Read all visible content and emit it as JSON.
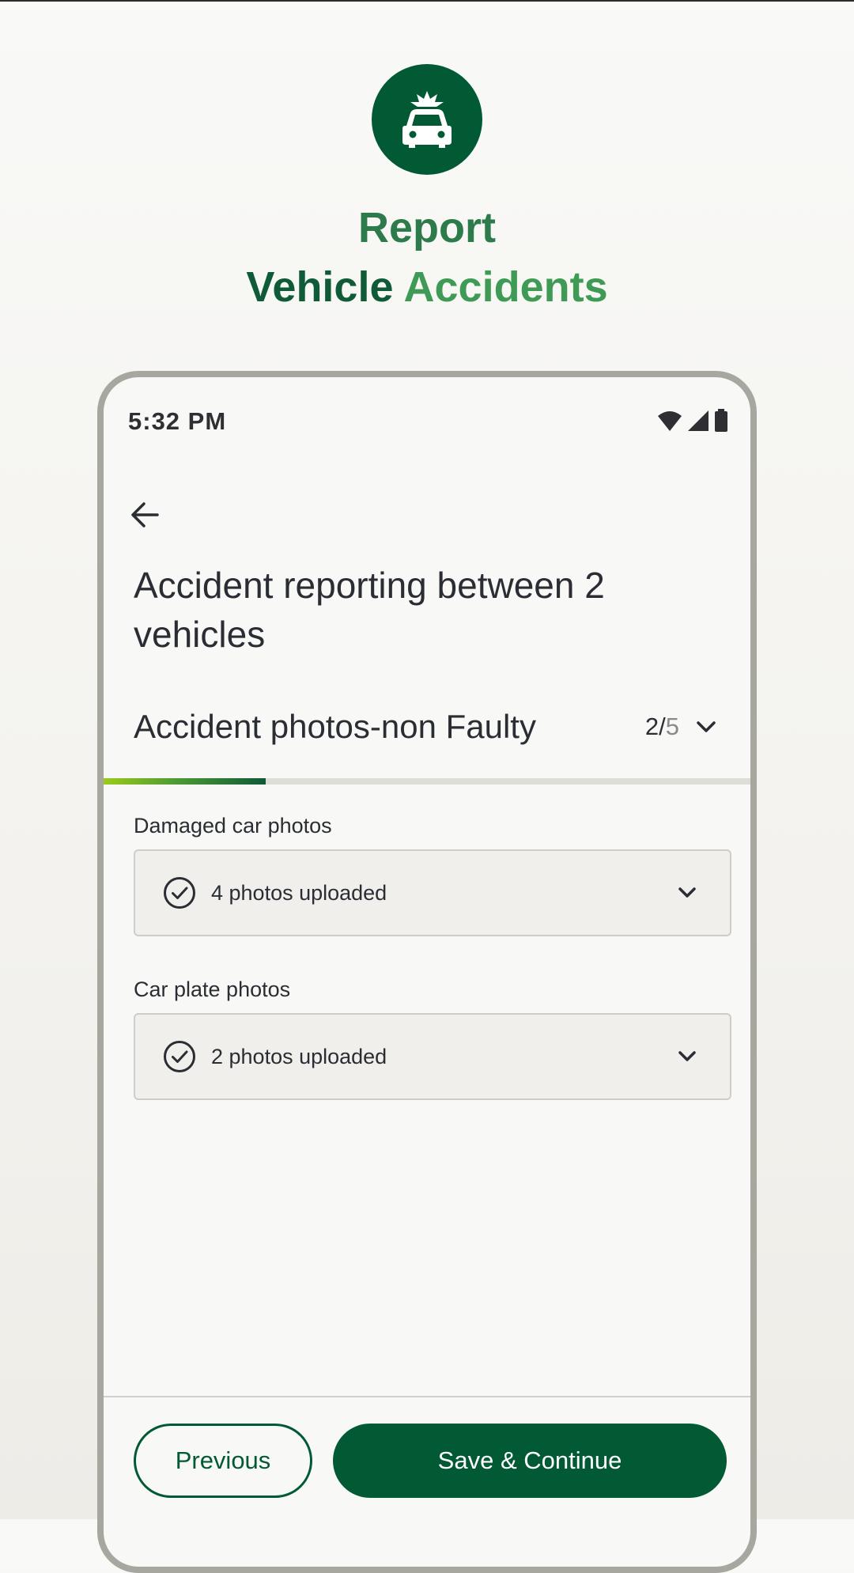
{
  "hero": {
    "title_line1": "Report",
    "title_word_a": "Vehicle",
    "title_word_b": "Accidents",
    "icon": "car-accident-icon"
  },
  "status_bar": {
    "time": "5:32 PM",
    "icons": [
      "wifi-icon",
      "cell-signal-icon",
      "battery-icon"
    ]
  },
  "header": {
    "back_icon": "arrow-left-icon",
    "title": "Accident reporting between 2 vehicles"
  },
  "section": {
    "title": "Accident photos-non Faulty",
    "step_current": "2",
    "step_total": "5",
    "progress": 0.25
  },
  "fields": [
    {
      "label": "Damaged car photos",
      "status": "4 photos uploaded"
    },
    {
      "label": "Car plate photos",
      "status": "2 photos uploaded"
    }
  ],
  "footer": {
    "previous_label": "Previous",
    "save_label": "Save & Continue"
  },
  "colors": {
    "brand_green": "#025a34",
    "accent_green": "#3f9a56",
    "progress_start": "#9ccb1a"
  }
}
